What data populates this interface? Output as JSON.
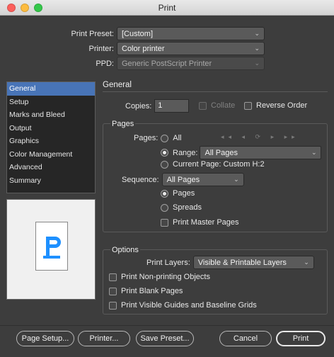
{
  "window": {
    "title": "Print"
  },
  "header": {
    "preset_label": "Print Preset:",
    "preset_value": "[Custom]",
    "printer_label": "Printer:",
    "printer_value": "Color printer",
    "ppd_label": "PPD:",
    "ppd_value": "Generic PostScript Printer"
  },
  "sidebar": {
    "items": [
      {
        "label": "General"
      },
      {
        "label": "Setup"
      },
      {
        "label": "Marks and Bleed"
      },
      {
        "label": "Output"
      },
      {
        "label": "Graphics"
      },
      {
        "label": "Color Management"
      },
      {
        "label": "Advanced"
      },
      {
        "label": "Summary"
      }
    ]
  },
  "general": {
    "title": "General",
    "copies_label": "Copies:",
    "copies_value": "1",
    "collate_label": "Collate",
    "reverse_label": "Reverse Order"
  },
  "pages": {
    "title": "Pages",
    "pages_label": "Pages:",
    "all_label": "All",
    "range_label": "Range:",
    "range_value": "All Pages",
    "current_label": "Current Page: Custom H:2",
    "sequence_label": "Sequence:",
    "sequence_value": "All Pages",
    "pages_option": "Pages",
    "spreads_option": "Spreads",
    "master_label": "Print Master Pages"
  },
  "options": {
    "title": "Options",
    "layers_label": "Print Layers:",
    "layers_value": "Visible & Printable Layers",
    "nonprinting_label": "Print Non-printing Objects",
    "blank_label": "Print Blank Pages",
    "guides_label": "Print Visible Guides and Baseline Grids"
  },
  "buttons": {
    "page_setup": "Page Setup...",
    "printer": "Printer...",
    "save_preset": "Save Preset...",
    "cancel": "Cancel",
    "print": "Print"
  },
  "colors": {
    "accent": "#4874b7",
    "preview_glyph": "#1e90ff"
  }
}
